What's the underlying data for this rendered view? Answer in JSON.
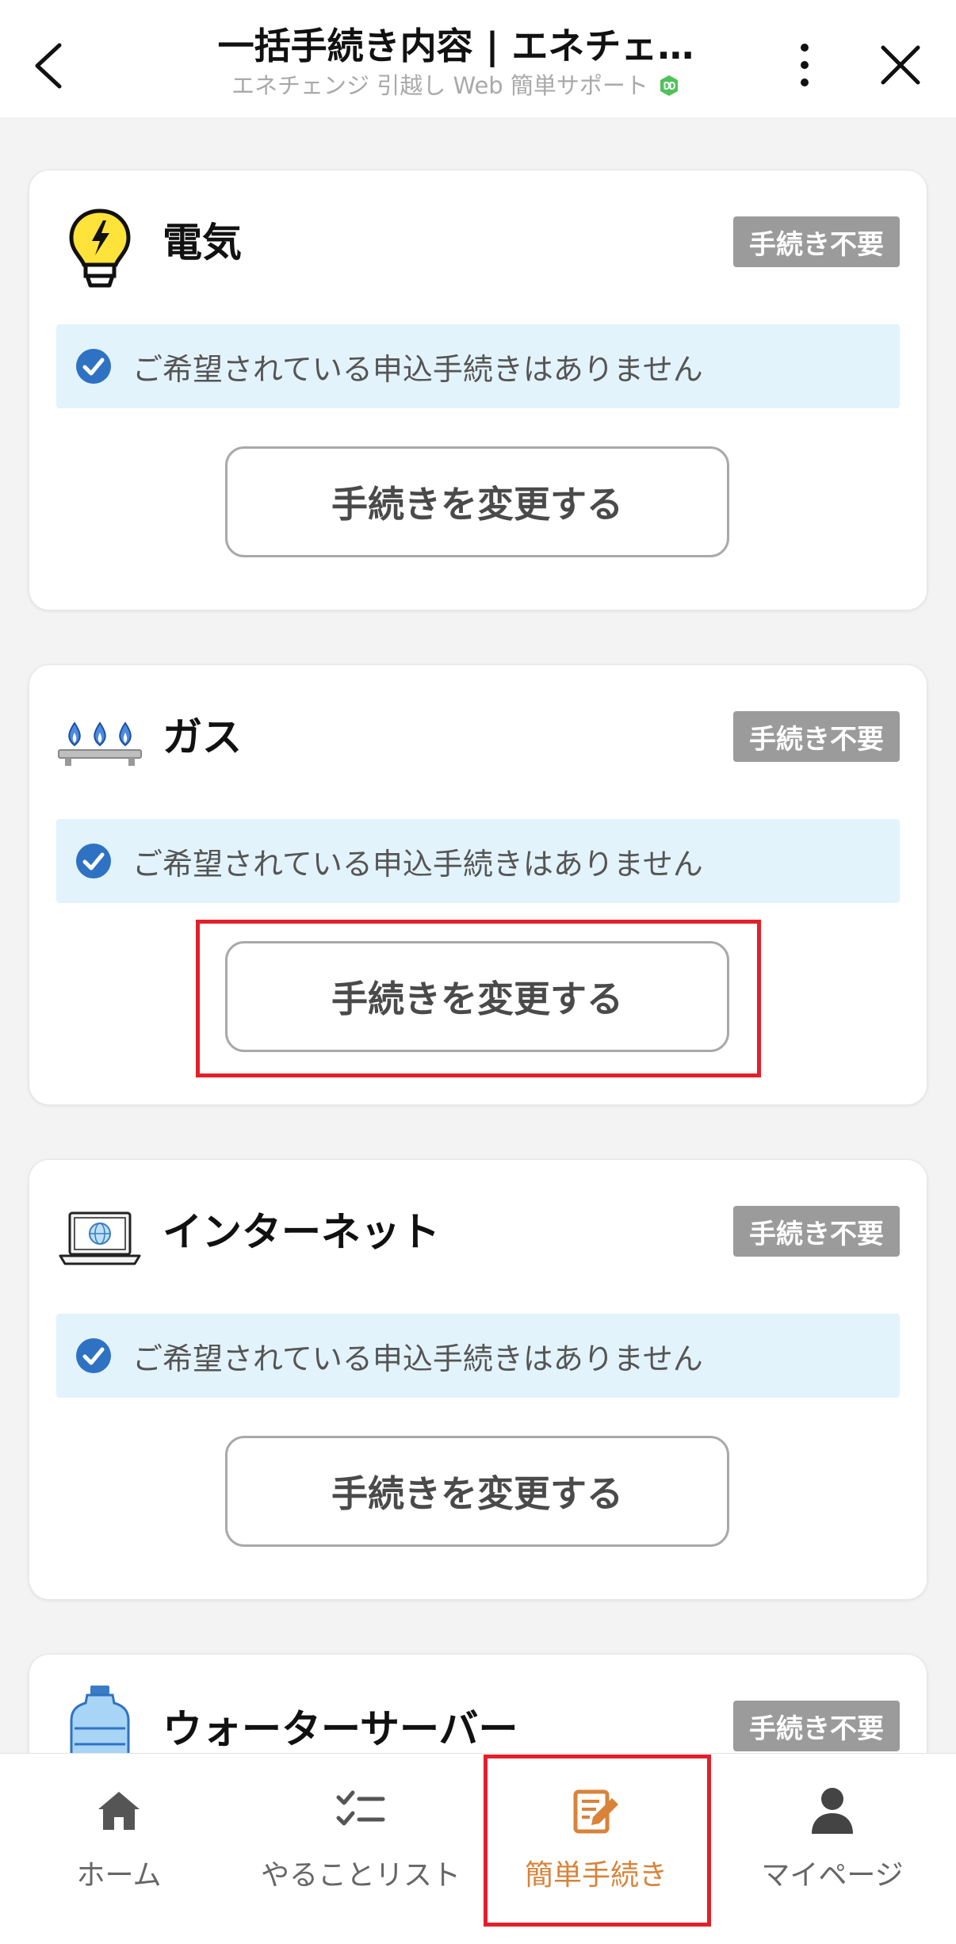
{
  "header": {
    "title": "一括手続き内容 | エネチェ…",
    "subtitle": "エネチェンジ 引越し Web 簡単サポート"
  },
  "cards": [
    {
      "title": "電気",
      "icon": "lightbulb-icon",
      "status": "手続き不要",
      "notice": "ご希望されている申込手続きはありません",
      "button": "手続きを変更する"
    },
    {
      "title": "ガス",
      "icon": "gas-stove-icon",
      "status": "手続き不要",
      "notice": "ご希望されている申込手続きはありません",
      "button": "手続きを変更する"
    },
    {
      "title": "インターネット",
      "icon": "laptop-icon",
      "status": "手続き不要",
      "notice": "ご希望されている申込手続きはありません",
      "button": "手続きを変更する"
    },
    {
      "title": "ウォーターサーバー",
      "icon": "water-bottle-icon",
      "status": "手続き不要"
    }
  ],
  "bottom_nav": [
    {
      "label": "ホーム",
      "icon": "home-icon",
      "active": false
    },
    {
      "label": "やることリスト",
      "icon": "checklist-icon",
      "active": false
    },
    {
      "label": "簡単手続き",
      "icon": "edit-document-icon",
      "active": true
    },
    {
      "label": "マイページ",
      "icon": "person-icon",
      "active": false
    }
  ],
  "colors": {
    "status_badge": "#9b9b9b",
    "notice_bg": "#e3f3fc",
    "check": "#2f72c4",
    "active_nav": "#d8833a",
    "highlight": "#e3202a"
  }
}
